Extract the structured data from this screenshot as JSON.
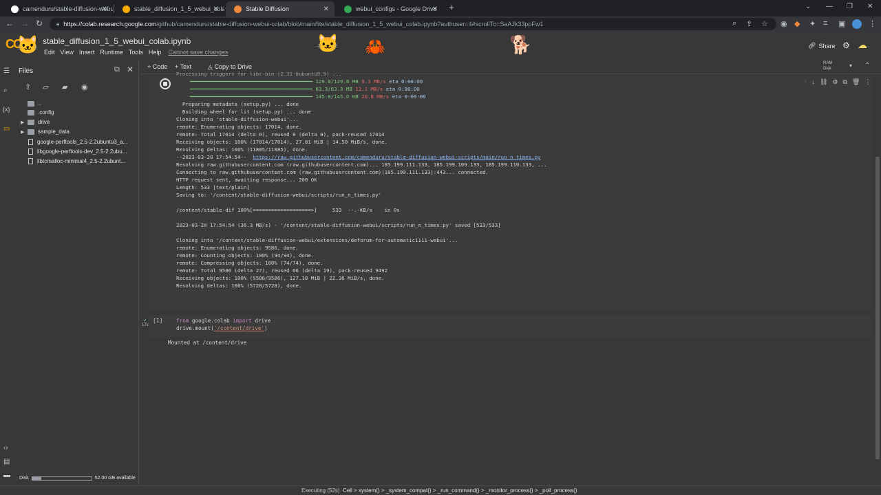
{
  "browser": {
    "tabs": [
      {
        "title": "camenduru/stable-diffusion-webu",
        "favicon_color": "#ffffff",
        "active": false
      },
      {
        "title": "stable_diffusion_1_5_webui_colab",
        "favicon_color": "#f9ab00",
        "active": false
      },
      {
        "title": "Stable Diffusion",
        "favicon_color": "#f28b3c",
        "active": true
      },
      {
        "title": "webui_configs - Google Drive",
        "favicon_color": "#34a853",
        "active": false
      }
    ],
    "url_host": "https://colab.research.google.com",
    "url_path": "/github/camenduru/stable-diffusion-webui-colab/blob/main/lite/stable_diffusion_1_5_webui_colab.ipynb?authuser=4#scrollTo=SaAJk33ppFw1"
  },
  "colab": {
    "logo": "CO",
    "notebook_title": "stable_diffusion_1_5_webui_colab.ipynb",
    "menus": [
      "Edit",
      "View",
      "Insert",
      "Runtime",
      "Tools",
      "Help"
    ],
    "cannot_save": "Cannot save changes",
    "share_label": "Share",
    "ram_label": "RAM",
    "disk_label": "Disk"
  },
  "toolbar": {
    "code_label": "Code",
    "text_label": "Text",
    "copy_label": "Copy to Drive"
  },
  "files_panel": {
    "title": "Files",
    "items": [
      {
        "name": "..",
        "type": "folder",
        "expandable": false
      },
      {
        "name": ".config",
        "type": "folder",
        "expandable": true
      },
      {
        "name": "drive",
        "type": "folder",
        "expandable": true
      },
      {
        "name": "sample_data",
        "type": "folder",
        "expandable": true
      },
      {
        "name": "google-perftools_2.5-2.2ubuntu3_a...",
        "type": "file",
        "expandable": false
      },
      {
        "name": "libgoogle-perftools-dev_2.5-2.2ubu...",
        "type": "file",
        "expandable": false
      },
      {
        "name": "libtcmalloc-minimal4_2.5-2.2ubunt...",
        "type": "file",
        "expandable": false
      }
    ],
    "disk_label": "Disk",
    "disk_available": "52.00 GB available",
    "disk_used_fraction": 0.15
  },
  "cell1": {
    "truncated_line": "Processing triggers for libc-bin (2.31-0ubuntu9.9) ...",
    "progress": [
      {
        "bar": "━━━━━━━━━━━━━━━━━━━━━━━━━━━━━━━━━━━━━━━━",
        "size": "129.8/129.8 MB",
        "speed": "8.3 MB/s",
        "eta": "eta 0:00:00"
      },
      {
        "bar": "━━━━━━━━━━━━━━━━━━━━━━━━━━━━━━━━━━━━━━━━",
        "size": "63.3/63.3 MB",
        "speed": "13.1 MB/s",
        "eta": "eta 0:00:00"
      },
      {
        "bar": "━━━━━━━━━━━━━━━━━━━━━━━━━━━━━━━━━━━━━━━━",
        "size": "145.0/145.0 KB",
        "speed": "20.8 MB/s",
        "eta": "eta 0:00:00"
      }
    ],
    "lines_a": "  Preparing metadata (setup.py) ... done\n  Building wheel for lit (setup.py) ... done\nCloning into 'stable-diffusion-webui'...\nremote: Enumerating objects: 17014, done.\nremote: Total 17014 (delta 0), reused 0 (delta 0), pack-reused 17014\nReceiving objects: 100% (17014/17014), 27.81 MiB | 14.50 MiB/s, done.\nResolving deltas: 100% (11885/11885), done.",
    "wget_prefix": "--2023-03-20 17:54:54--  ",
    "wget_url": "https://raw.githubusercontent.com/camenduru/stable-diffusion-webui-scripts/main/run_n_times.py",
    "lines_b": "Resolving raw.githubusercontent.com (raw.githubusercontent.com)... 185.199.111.133, 185.199.109.133, 185.199.110.133, ...\nConnecting to raw.githubusercontent.com (raw.githubusercontent.com)|185.199.111.133|:443... connected.\nHTTP request sent, awaiting response... 200 OK\nLength: 533 [text/plain]\nSaving to: '/content/stable-diffusion-webui/scripts/run_n_times.py'\n\n/content/stable-dif 100%[===================>]     533  --.-KB/s    in 0s\n\n2023-03-20 17:54:54 (36.3 MB/s) - '/content/stable-diffusion-webui/scripts/run_n_times.py' saved [533/533]\n\nCloning into '/content/stable-diffusion-webui/extensions/deforum-for-automatic1111-webui'...\nremote: Enumerating objects: 9586, done.\nremote: Counting objects: 100% (94/94), done.\nremote: Compressing objects: 100% (74/74), done.\nremote: Total 9586 (delta 27), reused 66 (delta 19), pack-reused 9492\nReceiving objects: 100% (9586/9586), 127.10 MiB | 22.36 MiB/s, done.\nResolving deltas: 100% (5728/5728), done."
  },
  "cell2": {
    "number": "[1]",
    "exec_time": "17s",
    "line1_kw1": "from",
    "line1_mod": " google.colab ",
    "line1_kw2": "import",
    "line1_name": " drive",
    "line2_pre": "drive.mount(",
    "line2_str": "'/content/drive'",
    "line2_post": ")",
    "output": "Mounted at /content/drive"
  },
  "status": {
    "executing": "Executing (52s)",
    "trace": "Cell > system() > _system_compat() > _run_command() > _monitor_process() > _poll_process()"
  }
}
